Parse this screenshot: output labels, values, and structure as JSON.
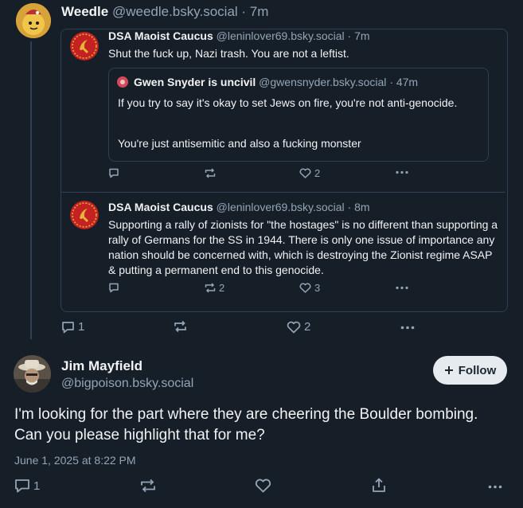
{
  "post1": {
    "author": "Weedle",
    "handle": "@weedle.bsky.social",
    "time": "· 7m"
  },
  "quote1": {
    "author": "DSA Maoist Caucus",
    "handle": "@leninlover69.bsky.social",
    "time": "· 7m",
    "text": "Shut the fuck up, Nazi trash. You are not a leftist.",
    "nested": {
      "author": "Gwen Snyder is uncivil",
      "handle": "@gwensnyder.bsky.social",
      "time": "· 47m",
      "text1": "If you try to say it's okay to set Jews on fire, you're not anti-genocide.",
      "text2": "You're just antisemitic and also a fucking monster"
    },
    "likes": "2"
  },
  "quote2": {
    "author": "DSA Maoist Caucus",
    "handle": "@leninlover69.bsky.social",
    "time": "· 8m",
    "text": "Supporting a rally of zionists for \"the hostages\" is no different than supporting a rally of Germans for the SS in 1944. There is only one issue of importance any nation should be concerned with, which is destroying the Zionist regime ASAP & putting a permanent end to this genocide.",
    "reposts": "2",
    "likes": "3"
  },
  "post1_actions": {
    "replies": "1",
    "likes": "2"
  },
  "post2": {
    "author": "Jim Mayfield",
    "handle": "@bigpoison.bsky.social",
    "follow_label": "Follow",
    "text": "I'm looking for the part where they are cheering the Boulder bombing. Can you please highlight that for me?",
    "timestamp": "June 1, 2025 at 8:22 PM",
    "replies": "1"
  },
  "icons": [
    "reply-icon",
    "repost-icon",
    "like-icon",
    "more-icon",
    "share-icon",
    "plus-icon"
  ],
  "colors": {
    "background": "#161e27",
    "muted": "#93a5b7",
    "border": "#2e4052",
    "follow_bg": "#e6ebf0"
  }
}
